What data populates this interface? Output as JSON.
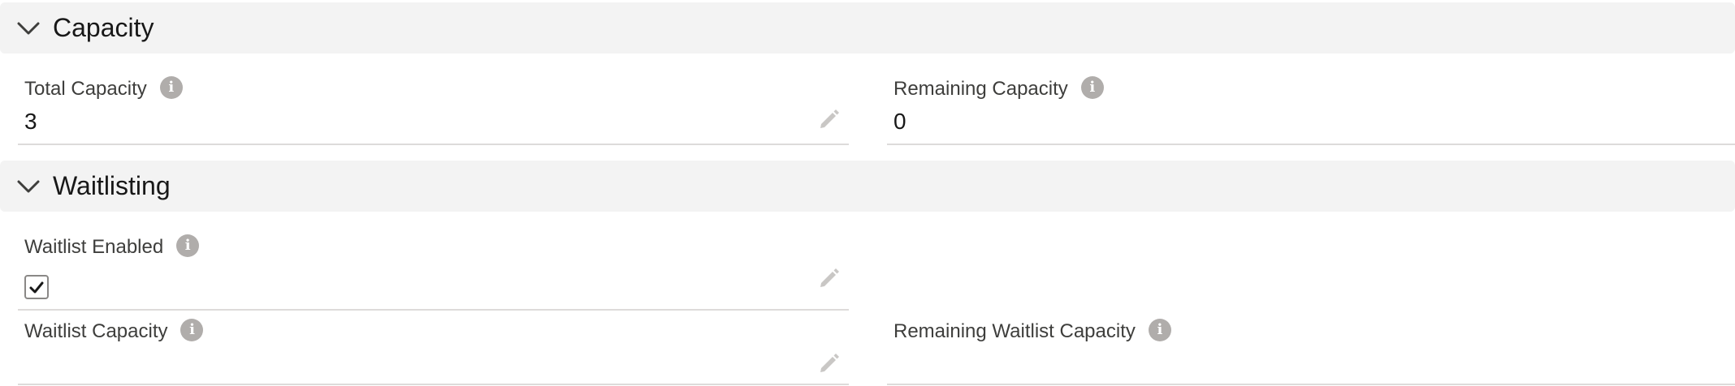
{
  "capacity_section": {
    "title": "Capacity",
    "fields": {
      "total_capacity": {
        "label": "Total Capacity",
        "value": "3"
      },
      "remaining_capacity": {
        "label": "Remaining Capacity",
        "value": "0"
      }
    }
  },
  "waitlisting_section": {
    "title": "Waitlisting",
    "fields": {
      "waitlist_enabled": {
        "label": "Waitlist Enabled",
        "checked": true
      },
      "waitlist_capacity": {
        "label": "Waitlist Capacity",
        "value": ""
      },
      "remaining_waitlist_capacity": {
        "label": "Remaining Waitlist Capacity",
        "value": ""
      }
    }
  },
  "icons": {
    "chevron": "chevron-down-icon",
    "info": "info-icon",
    "edit": "pencil-icon",
    "check": "checkmark-icon"
  },
  "colors": {
    "header_bg": "#f3f3f3",
    "info_icon": "#b0adab",
    "pencil_icon": "#c9c7c5",
    "divider": "#dddbda"
  }
}
